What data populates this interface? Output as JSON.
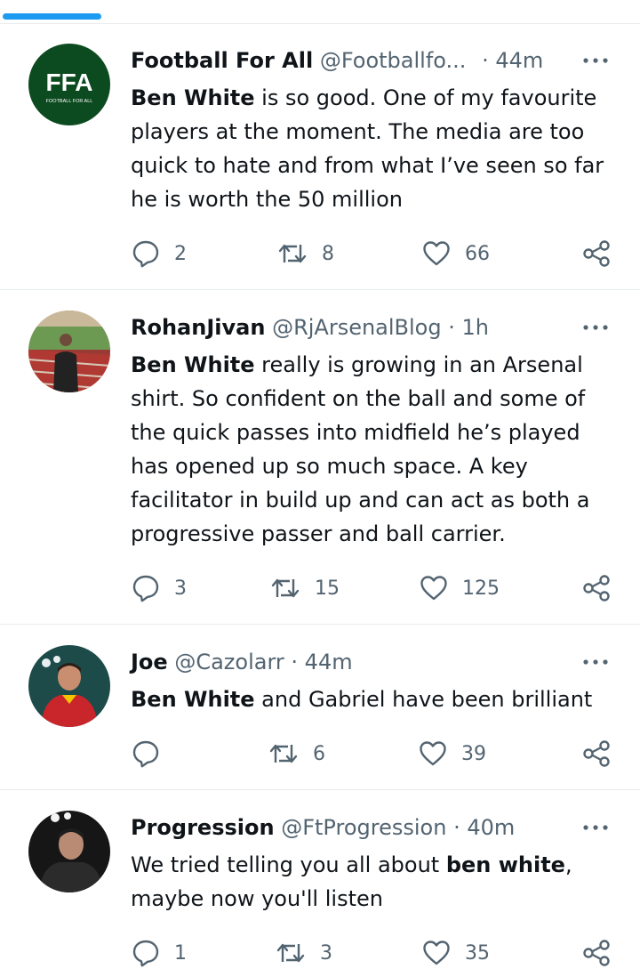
{
  "colors": {
    "accent": "#1d9bf0",
    "text": "#0f1419",
    "muted": "#536471",
    "divider": "#e8ecef"
  },
  "tweets": [
    {
      "avatar_text": "FFA",
      "avatar_subtext": "FOOTBALL FOR ALL",
      "name": "Football For All",
      "handle": "@Footballfo...",
      "time": "· 44m",
      "body_parts": [
        {
          "text": "Ben White",
          "bold": true
        },
        {
          "text": " is so good. One of my favourite players at the moment. The media are too quick to hate and from what I’ve seen so far he is worth the 50 million",
          "bold": false
        }
      ],
      "replies": "2",
      "retweets": "8",
      "likes": "66"
    },
    {
      "name": "RohanJivan",
      "handle": "@RjArsenalBlog",
      "time": "· 1h",
      "body_parts": [
        {
          "text": "Ben White",
          "bold": true
        },
        {
          "text": " really is growing in an Arsenal shirt. So confident on the ball and some of the quick passes into midfield he’s played has opened up so much space. A key facilitator in build up and can act as both a progressive passer and ball carrier.",
          "bold": false
        }
      ],
      "replies": "3",
      "retweets": "15",
      "likes": "125"
    },
    {
      "name": "Joe",
      "handle": "@Cazolarr",
      "time": "· 44m",
      "body_parts": [
        {
          "text": "Ben White",
          "bold": true
        },
        {
          "text": " and Gabriel have been brilliant",
          "bold": false
        }
      ],
      "replies": "",
      "retweets": "6",
      "likes": "39"
    },
    {
      "name": "Progression",
      "handle": "@FtProgression",
      "time": "· 40m",
      "body_parts": [
        {
          "text": "We tried telling you all about ",
          "bold": false
        },
        {
          "text": "ben white",
          "bold": true
        },
        {
          "text": ", maybe now you'll listen",
          "bold": false
        }
      ],
      "replies": "1",
      "retweets": "3",
      "likes": "35"
    }
  ]
}
